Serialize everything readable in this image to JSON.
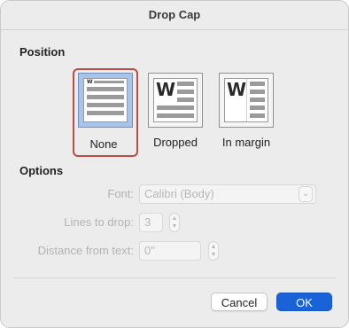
{
  "dialog": {
    "title": "Drop Cap"
  },
  "position": {
    "label": "Position",
    "options": [
      {
        "label": "None",
        "selected": true
      },
      {
        "label": "Dropped",
        "selected": false,
        "letter": "W"
      },
      {
        "label": "In margin",
        "selected": false,
        "letter": "W"
      }
    ],
    "none_letter": "W"
  },
  "options": {
    "label": "Options",
    "font_label": "Font:",
    "font_value": "Calibri (Body)",
    "lines_label": "Lines to drop:",
    "lines_value": "3",
    "distance_label": "Distance from text:",
    "distance_value": "0\""
  },
  "buttons": {
    "cancel": "Cancel",
    "ok": "OK"
  },
  "colors": {
    "accent": "#1a62d8",
    "selection_border": "#b94e45",
    "selected_tile": "#a9c4ea"
  }
}
